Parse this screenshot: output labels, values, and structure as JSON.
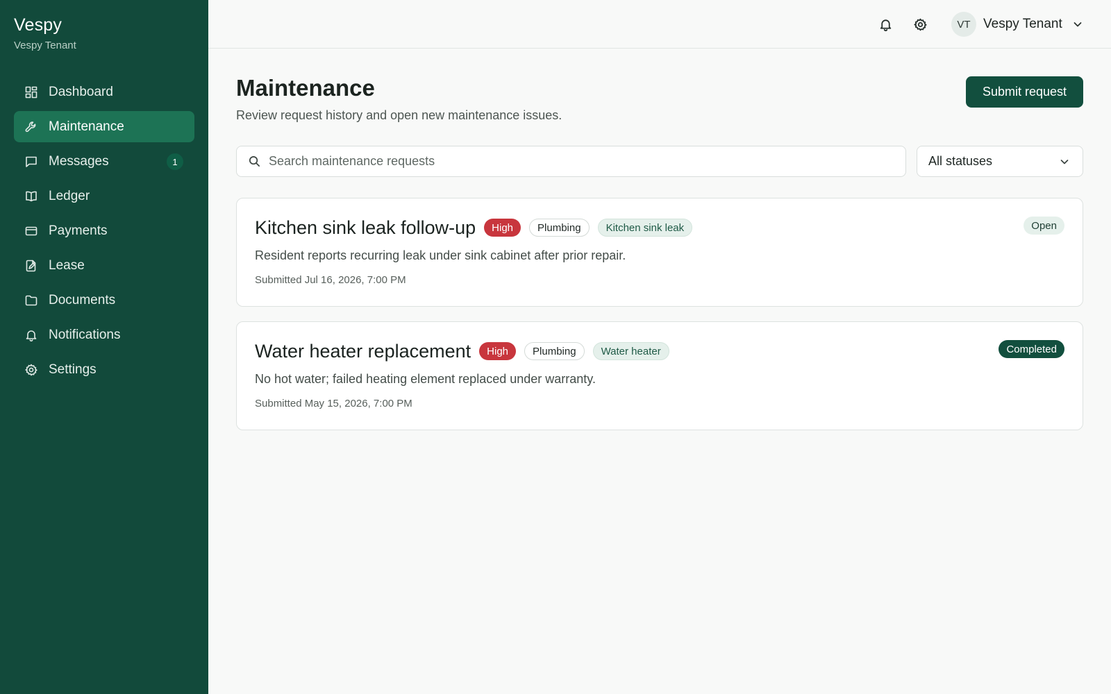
{
  "brand": {
    "name": "Vespy",
    "subtitle": "Vespy Tenant"
  },
  "sidebar": {
    "items": [
      {
        "label": "Dashboard",
        "icon": "dashboard-icon",
        "active": false
      },
      {
        "label": "Maintenance",
        "icon": "wrench-icon",
        "active": true
      },
      {
        "label": "Messages",
        "icon": "message-icon",
        "active": false,
        "badge": "1"
      },
      {
        "label": "Ledger",
        "icon": "book-icon",
        "active": false
      },
      {
        "label": "Payments",
        "icon": "credit-card-icon",
        "active": false
      },
      {
        "label": "Lease",
        "icon": "document-edit-icon",
        "active": false
      },
      {
        "label": "Documents",
        "icon": "folder-icon",
        "active": false
      },
      {
        "label": "Notifications",
        "icon": "bell-icon",
        "active": false
      },
      {
        "label": "Settings",
        "icon": "gear-icon",
        "active": false
      }
    ]
  },
  "topbar": {
    "notification_icon": "bell-icon",
    "settings_icon": "gear-icon",
    "user": {
      "initials": "VT",
      "name": "Vespy Tenant"
    }
  },
  "page": {
    "title": "Maintenance",
    "subtitle": "Review request history and open new maintenance issues.",
    "submit_label": "Submit request"
  },
  "filters": {
    "search_placeholder": "Search maintenance requests",
    "search_value": "",
    "status_selected": "All statuses"
  },
  "requests": [
    {
      "title": "Kitchen sink leak follow-up",
      "priority": "High",
      "category": "Plumbing",
      "tag": "Kitchen sink leak",
      "status": "Open",
      "description": "Resident reports recurring leak under sink cabinet after prior repair.",
      "submitted": "Submitted Jul 16, 2026, 7:00 PM"
    },
    {
      "title": "Water heater replacement",
      "priority": "High",
      "category": "Plumbing",
      "tag": "Water heater",
      "status": "Completed",
      "description": "No hot water; failed heating element replaced under warranty.",
      "submitted": "Submitted May 15, 2026, 7:00 PM"
    }
  ],
  "colors": {
    "sidebar_bg": "#124a3b",
    "active_item": "#1d7355",
    "primary_button": "#124f3e",
    "priority_high": "#c8363d",
    "status_open_bg": "#e5f0eb",
    "status_completed_bg": "#124f3e"
  }
}
